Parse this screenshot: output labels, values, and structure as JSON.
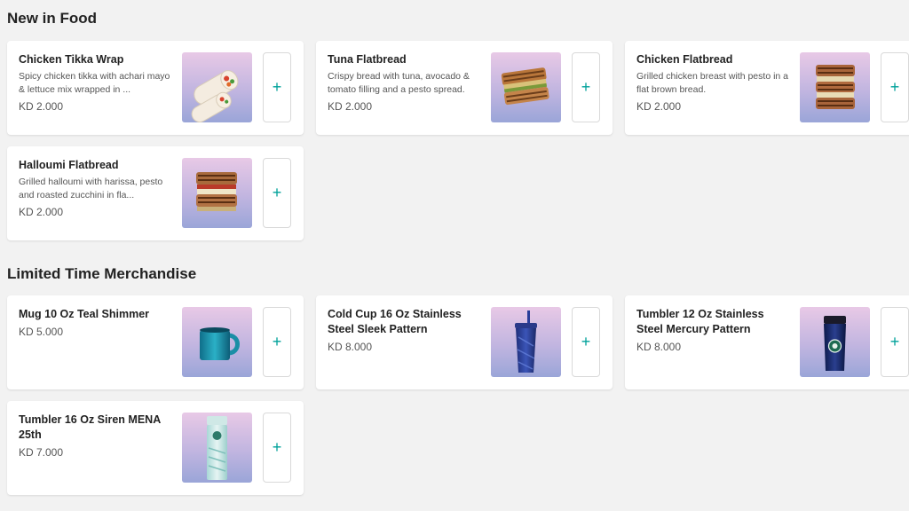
{
  "sections": [
    {
      "title": "New in Food",
      "items": [
        {
          "name": "Chicken Tikka Wrap",
          "desc": "Spicy chicken tikka with achari mayo & lettuce mix wrapped in ...",
          "price": "KD 2.000",
          "icon": "wrap-icon"
        },
        {
          "name": "Tuna Flatbread",
          "desc": "Crispy bread with tuna, avocado & tomato filling and a pesto spread.",
          "price": "KD 2.000",
          "icon": "flatbread-icon"
        },
        {
          "name": "Chicken Flatbread",
          "desc": "Grilled chicken breast with pesto in a flat brown bread.",
          "price": "KD 2.000",
          "icon": "flatbread-icon"
        },
        {
          "name": "Halloumi Flatbread",
          "desc": "Grilled halloumi with harissa, pesto and roasted zucchini in fla...",
          "price": "KD 2.000",
          "icon": "flatbread-icon"
        }
      ]
    },
    {
      "title": "Limited Time Merchandise",
      "items": [
        {
          "name": "Mug 10 Oz Teal Shimmer",
          "desc": "",
          "price": "KD 5.000",
          "icon": "mug-icon"
        },
        {
          "name": "Cold Cup 16 Oz Stainless Steel Sleek Pattern",
          "desc": "",
          "price": "KD 8.000",
          "icon": "cold-cup-icon"
        },
        {
          "name": "Tumbler 12 Oz Stainless Steel Mercury Pattern",
          "desc": "",
          "price": "KD 8.000",
          "icon": "tumbler-icon"
        },
        {
          "name": "Tumbler 16 Oz Siren MENA 25th",
          "desc": "",
          "price": "KD 7.000",
          "icon": "tall-tumbler-icon"
        }
      ]
    }
  ],
  "add_label": "+",
  "colors": {
    "accent": "#00a19a",
    "background": "#f2f2f2",
    "card": "#ffffff"
  }
}
